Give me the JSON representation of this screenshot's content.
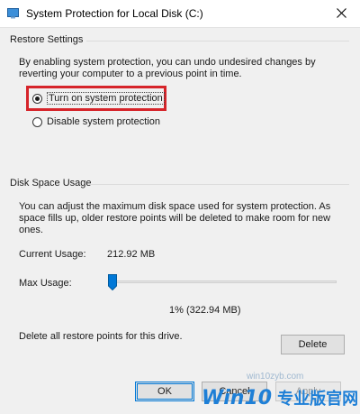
{
  "window": {
    "title": "System Protection for Local Disk (C:)"
  },
  "restore_settings": {
    "group_label": "Restore Settings",
    "description_line1": "By enabling system protection, you can undo undesired changes by",
    "description_line2": "reverting your computer to a previous point in time.",
    "options": [
      {
        "label": "Turn on system protection",
        "selected": true
      },
      {
        "label": "Disable system protection",
        "selected": false
      }
    ]
  },
  "disk_space": {
    "group_label": "Disk Space Usage",
    "description_line1": "You can adjust the maximum disk space used for system protection. As",
    "description_line2": "space fills up, older restore points will be deleted to make room for new",
    "description_line3": "ones.",
    "current_usage_label": "Current Usage:",
    "current_usage_value": "212.92 MB",
    "max_usage_label": "Max Usage:",
    "max_usage_percent": 0.01,
    "max_usage_readout": "1% (322.94 MB)",
    "delete_text": "Delete all restore points for this drive.",
    "delete_button": "Delete"
  },
  "footer": {
    "ok": "OK",
    "cancel": "Cancel",
    "apply": "Apply"
  },
  "watermark": {
    "url": "win10zyb.com",
    "brand": "Win10",
    "suffix": "专业版官网"
  },
  "colors": {
    "highlight": "#d6242a",
    "accent": "#0078d7",
    "watermark": "#1e7fd6"
  }
}
